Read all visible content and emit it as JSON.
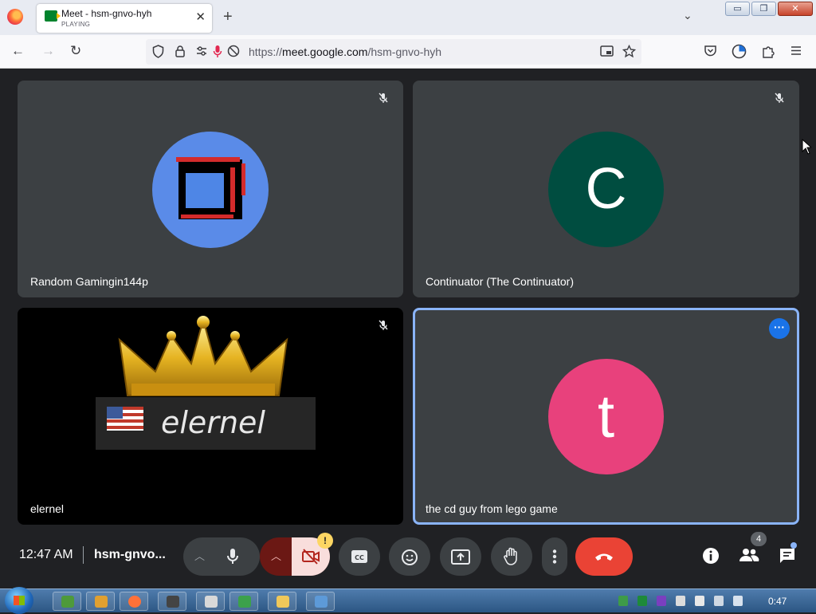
{
  "browser": {
    "tab": {
      "title": "Meet - hsm-gnvo-hyh",
      "status": "PLAYING",
      "close": "✕"
    },
    "new_tab": "+",
    "tab_list": "⌄",
    "window_buttons": {
      "minimize": "▭",
      "restore": "❐",
      "close": "✕"
    },
    "url": {
      "prefix": "https://",
      "host": "meet.google.com",
      "path": "/hsm-gnvo-hyh"
    },
    "nav": {
      "back": "←",
      "forward": "→",
      "reload": "↻"
    }
  },
  "meeting": {
    "tiles": [
      {
        "name": "Random Gamingin144p",
        "avatar_color": "#5a8be8",
        "muted": true
      },
      {
        "name": "Continuator (The Continuator)",
        "initial": "C",
        "avatar_color": "#004d40",
        "muted": true
      },
      {
        "name": "elernel",
        "video_caption": "elernel",
        "muted": true
      },
      {
        "name": "the cd guy from lego game",
        "initial": "t",
        "avatar_color": "#e8417c",
        "active_speaker": true
      }
    ],
    "bottom_bar": {
      "time": "12:47 AM",
      "meeting_code": "hsm-gnvo...",
      "participants_count": "4",
      "camera_warning": "!"
    }
  },
  "taskbar": {
    "clock": "0:47"
  },
  "colors": {
    "stage_bg": "#202124",
    "tile_bg": "#3c4043",
    "hangup_red": "#ea4335",
    "active_border": "#8ab4f8"
  }
}
